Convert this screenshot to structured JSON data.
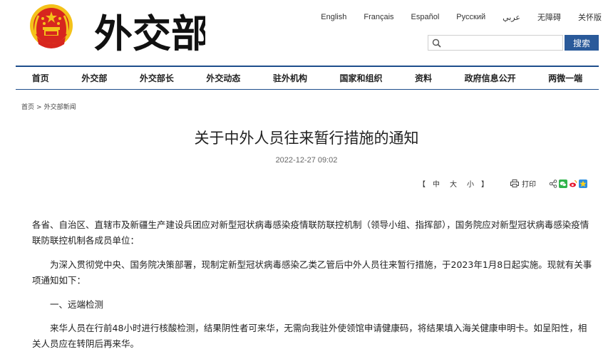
{
  "header": {
    "logo_text": "外交部",
    "search": {
      "placeholder": "",
      "button_label": "搜索"
    },
    "languages": [
      "English",
      "Français",
      "Español",
      "Русский",
      "عربي",
      "无障碍",
      "关怀版"
    ]
  },
  "nav": [
    "首页",
    "外交部",
    "外交部长",
    "外交动态",
    "驻外机构",
    "国家和组织",
    "资料",
    "政府信息公开",
    "两微一端"
  ],
  "breadcrumb": {
    "home": "首页",
    "sep": ">",
    "current": "外交部新闻"
  },
  "article": {
    "title": "关于中外人员往来暂行措施的通知",
    "date": "2022-12-27 09:02",
    "font_size": {
      "open": "【",
      "large": "中",
      "medium": "大",
      "small": "小",
      "close": "】"
    },
    "print_label": "打印",
    "paragraphs": [
      "各省、自治区、直辖市及新疆生产建设兵团应对新型冠状病毒感染疫情联防联控机制（领导小组、指挥部），国务院应对新型冠状病毒感染疫情联防联控机制各成员单位：",
      "为深入贯彻党中央、国务院决策部署，现制定新型冠状病毒感染乙类乙管后中外人员往来暂行措施，于2023年1月8日起实施。现就有关事项通知如下：",
      "一、远端检测",
      "来华人员在行前48小时进行核酸检测，结果阴性者可来华，无需向我驻外使领馆申请健康码，将结果填入海关健康申明卡。如呈阳性，相关人员应在转阴后再来华。"
    ]
  },
  "colors": {
    "nav_border": "#1e4e8c",
    "search_button": "#2a5a9a",
    "emblem_red": "#d7261e",
    "emblem_gold": "#f4c21a"
  }
}
